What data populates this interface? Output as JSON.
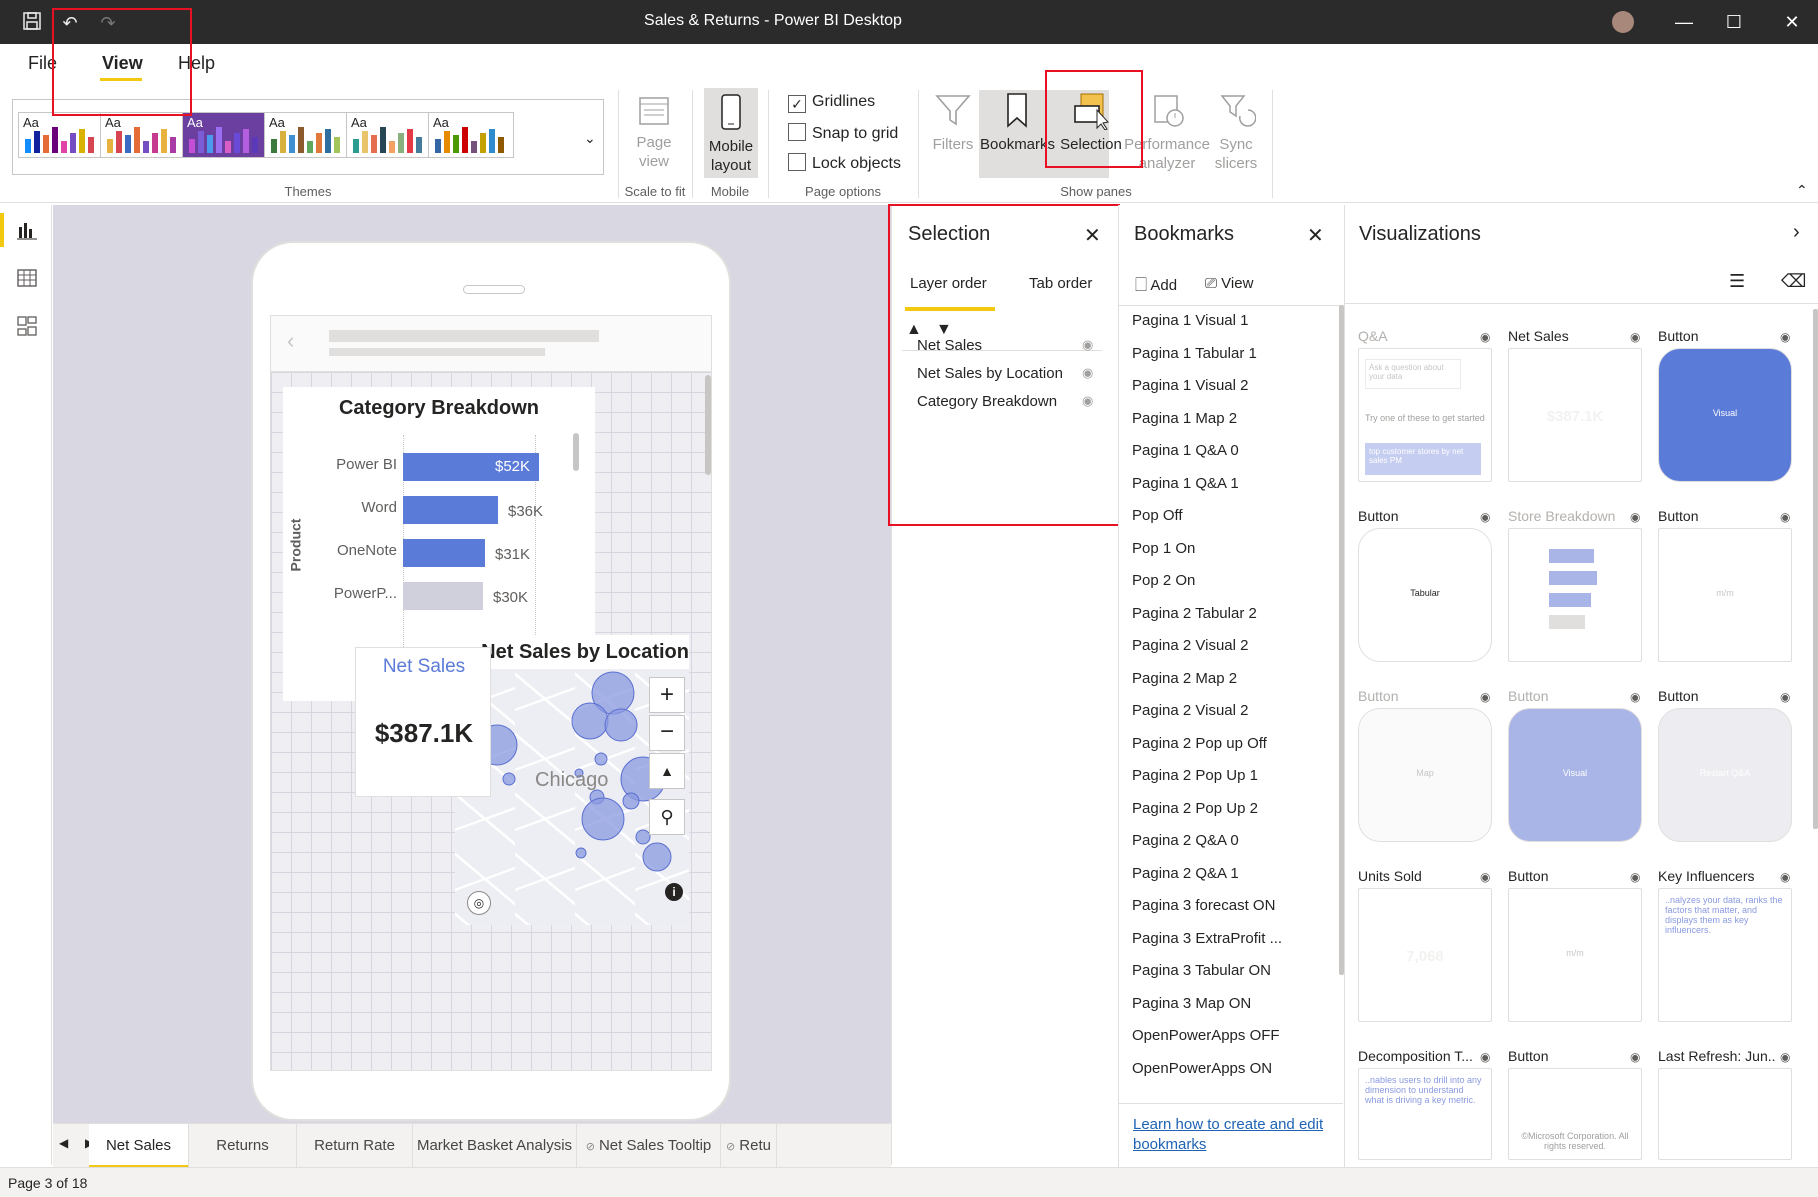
{
  "window": {
    "title": "Sales & Returns - Power BI Desktop"
  },
  "menu": {
    "file": "File",
    "view": "View",
    "help": "Help"
  },
  "ribbon": {
    "themes_label": "Themes",
    "theme_aa": "Aa",
    "page_view": "Page view",
    "scale_to_fit": "Scale to fit",
    "mobile_layout": "Mobile layout",
    "mobile_group": "Mobile",
    "gridlines": "Gridlines",
    "snap_to_grid": "Snap to grid",
    "lock_objects": "Lock objects",
    "page_options": "Page options",
    "filters": "Filters",
    "bookmarks": "Bookmarks",
    "selection": "Selection",
    "performance_analyzer": "Performance analyzer",
    "sync_slicers": "Sync slicers",
    "show_panes": "Show panes",
    "gridlines_checked": true,
    "snap_checked": false,
    "lock_checked": false
  },
  "canvas": {
    "category_breakdown": {
      "title": "Category Breakdown",
      "axis_label": "Product",
      "bars": [
        {
          "label": "Power BI",
          "value": "$52K",
          "pct": 1.0,
          "color": "#5b7bd8",
          "inside": true
        },
        {
          "label": "Word",
          "value": "$36K",
          "pct": 0.7,
          "color": "#5b7bd8",
          "inside": false
        },
        {
          "label": "OneNote",
          "value": "$31K",
          "pct": 0.6,
          "color": "#5b7bd8",
          "inside": false
        },
        {
          "label": "PowerP...",
          "value": "$30K",
          "pct": 0.59,
          "color": "#cfd0dc",
          "inside": false
        }
      ]
    },
    "net_sales_card": {
      "title": "Net Sales",
      "value": "$387.1K"
    },
    "map": {
      "title": "Net Sales by Location",
      "city": "Chicago"
    }
  },
  "selection_pane": {
    "title": "Selection",
    "tab_layer": "Layer order",
    "tab_tab": "Tab order",
    "items": [
      "Net Sales",
      "Net Sales by Location",
      "Category Breakdown"
    ]
  },
  "bookmarks_pane": {
    "title": "Bookmarks",
    "add": "Add",
    "view": "View",
    "items": [
      "Pagina 1 Visual 1",
      "Pagina 1 Tabular 1",
      "Pagina 1 Visual 2",
      "Pagina 1 Map 2",
      "Pagina 1 Q&A 0",
      "Pagina 1 Q&A 1",
      "Pop Off",
      "Pop 1 On",
      "Pop 2 On",
      "Pagina 2 Tabular 2",
      "Pagina 2 Visual 2",
      "Pagina 2 Map 2",
      "Pagina 2 Visual 2",
      "Pagina 2 Pop up Off",
      "Pagina 2 Pop Up 1",
      "Pagina 2 Pop Up 2",
      "Pagina 2 Q&A 0",
      "Pagina 2 Q&A 1",
      "Pagina 3 forecast ON",
      "Pagina 3 ExtraProfit ...",
      "Pagina 3 Tabular ON",
      "Pagina 3 Map ON",
      "OpenPowerApps OFF",
      "OpenPowerApps ON"
    ],
    "learn_link": "Learn how to create and edit bookmarks"
  },
  "visualizations_pane": {
    "title": "Visualizations",
    "tiles": [
      {
        "label": "Q&A",
        "dim": true,
        "inner": "Try one of these to get started",
        "extra": "Ask a question about your data",
        "chip": "top customer stores by net sales PM"
      },
      {
        "label": "Net Sales",
        "dim": false,
        "inner": "$387.1K"
      },
      {
        "label": "Button",
        "dim": false,
        "inner": "Visual"
      },
      {
        "label": "Button",
        "dim": false,
        "inner": "Tabular"
      },
      {
        "label": "Store Breakdown",
        "dim": true,
        "inner": ""
      },
      {
        "label": "Button",
        "dim": false,
        "inner": "m/m"
      },
      {
        "label": "Button",
        "dim": true,
        "inner": "Map"
      },
      {
        "label": "Button",
        "dim": true,
        "inner": "Visual"
      },
      {
        "label": "Button",
        "dim": false,
        "inner": "Restart Q&A"
      },
      {
        "label": "Units Sold",
        "dim": false,
        "inner": "7,068"
      },
      {
        "label": "Button",
        "dim": false,
        "inner": "m/m"
      },
      {
        "label": "Key Influencers",
        "dim": false,
        "inner": "..nalyzes your data, ranks the factors that matter, and displays them as key influencers."
      },
      {
        "label": "Decomposition T...",
        "dim": false,
        "inner": "..nables users to drill into any dimension to understand what is driving a key metric."
      },
      {
        "label": "Button",
        "dim": false,
        "inner": "©Microsoft Corporation. All rights reserved."
      },
      {
        "label": "Last Refresh: Jun...",
        "dim": false,
        "inner": ""
      }
    ]
  },
  "page_tabs": [
    "Net Sales",
    "Returns",
    "Return Rate",
    "Market Basket Analysis",
    "Net Sales Tooltip",
    "Retu"
  ],
  "status": {
    "page": "Page 3 of 18"
  }
}
